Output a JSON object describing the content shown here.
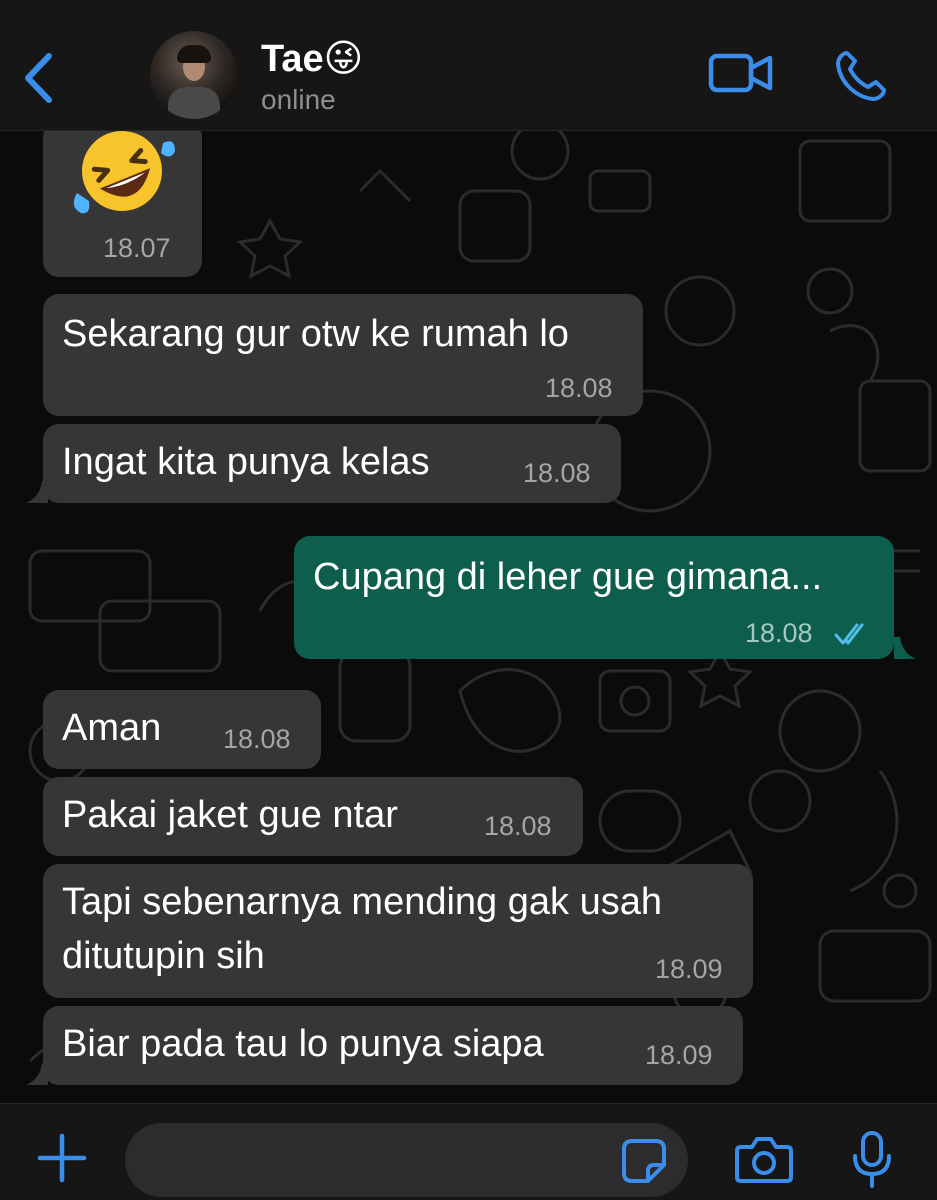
{
  "header": {
    "contact_name": "Tae😜",
    "status": "online"
  },
  "messages": [
    {
      "direction": "in",
      "content": "🤣",
      "time": "18.07"
    },
    {
      "direction": "in",
      "text": "Sekarang gur otw ke rumah lo",
      "time": "18.08"
    },
    {
      "direction": "in",
      "text": "Ingat kita punya kelas",
      "time": "18.08"
    },
    {
      "direction": "out",
      "text": "Cupang di leher gue gimana...",
      "time": "18.08",
      "status": "read"
    },
    {
      "direction": "in",
      "text": "Aman",
      "time": "18.08"
    },
    {
      "direction": "in",
      "text": "Pakai jaket gue ntar",
      "time": "18.08"
    },
    {
      "direction": "in",
      "lines": [
        "Tapi sebenarnya mending gak usah",
        "ditutupin sih"
      ],
      "time": "18.09"
    },
    {
      "direction": "in",
      "text": "Biar pada tau lo punya siapa",
      "time": "18.09"
    }
  ],
  "composer": {
    "placeholder": ""
  },
  "icons": {
    "back": "chevron-left-icon",
    "video": "video-camera-icon",
    "call": "phone-icon",
    "attach": "plus-icon",
    "sticker": "sticker-icon",
    "camera": "camera-icon",
    "mic": "microphone-icon",
    "read_receipt": "double-check-icon"
  },
  "colors": {
    "accent": "#3a8eea",
    "incoming_bubble": "#363636",
    "outgoing_bubble": "#0e5e4e",
    "read_tick": "#53bdeb",
    "background": "#0b0b0b"
  }
}
